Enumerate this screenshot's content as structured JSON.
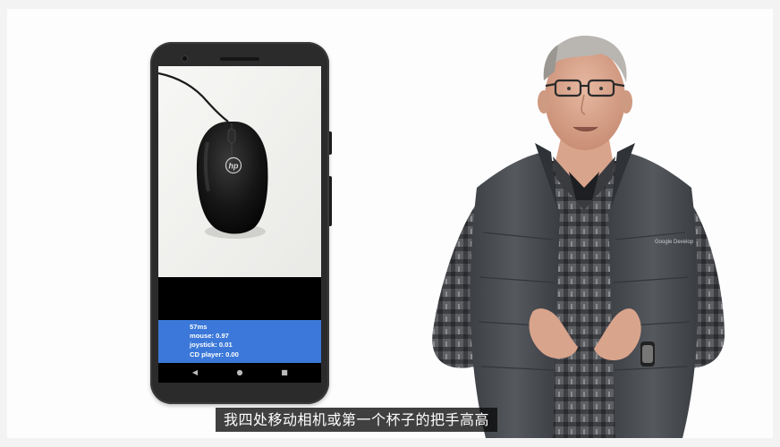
{
  "phone": {
    "results": {
      "latency": "57ms",
      "lines": [
        "mouse: 0.97",
        "joystick: 0.01",
        "CD player: 0.00"
      ]
    },
    "nav": {
      "back": "◀",
      "home": "●",
      "recents": "■"
    },
    "mouse_logo": "hp"
  },
  "presenter": {
    "vest_logo": "Google Develop"
  },
  "subtitle": "我四处移动相机或第一个杯子的把手高高",
  "colors": {
    "results_bg": "#3b78d9",
    "background": "#fdfdfd",
    "vest": "#4a4d52",
    "shirt_plaid": "#6d6e72"
  }
}
